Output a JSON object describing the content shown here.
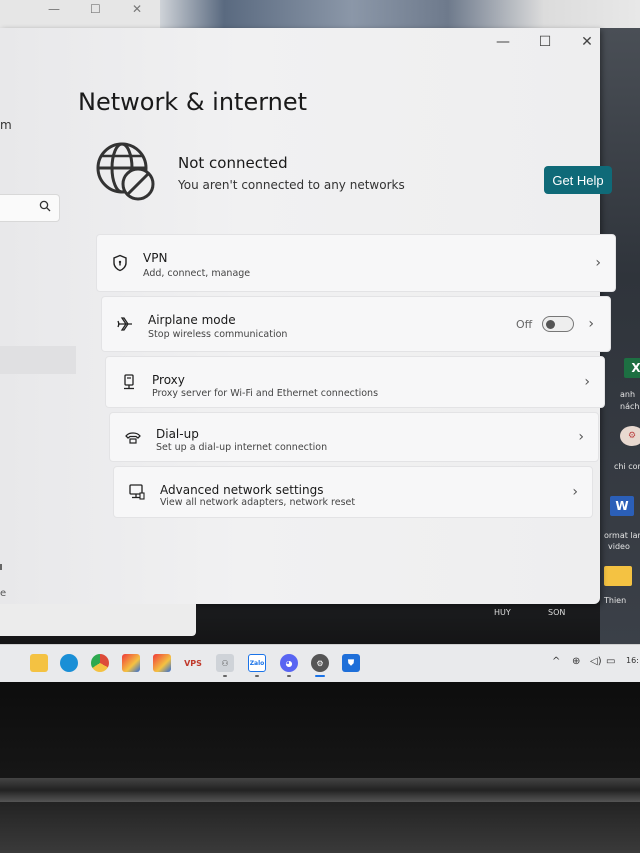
{
  "window": {
    "controls": {
      "minimize": "—",
      "maximize": "☐",
      "close": "✕"
    },
    "left_pane": {
      "crumb": "m",
      "search_icon": "search-icon",
      "ellipsis": "e"
    }
  },
  "page": {
    "title": "Network & internet"
  },
  "status": {
    "title": "Not connected",
    "subtitle": "You aren't connected to any networks",
    "help_button": "Get Help",
    "icon": "globe-blocked-icon"
  },
  "settings": [
    {
      "id": "vpn",
      "icon": "shield-icon",
      "title": "VPN",
      "subtitle": "Add, connect, manage"
    },
    {
      "id": "airplane",
      "icon": "airplane-icon",
      "title": "Airplane mode",
      "subtitle": "Stop wireless communication",
      "toggle_label": "Off",
      "toggle_on": false
    },
    {
      "id": "proxy",
      "icon": "proxy-icon",
      "title": "Proxy",
      "subtitle": "Proxy server for Wi-Fi and Ethernet connections"
    },
    {
      "id": "dialup",
      "icon": "dialup-icon",
      "title": "Dial-up",
      "subtitle": "Set up a dial-up internet connection"
    },
    {
      "id": "advanced",
      "icon": "monitor-network-icon",
      "title": "Advanced network settings",
      "subtitle": "View all network adapters, network reset"
    }
  ],
  "desktop": {
    "right_labels": [
      "anh",
      "nách",
      "chi cor",
      "ormat lar",
      "video",
      "Thien"
    ],
    "bottom_labels": [
      "HUY",
      "SON"
    ],
    "excel_glyph": "X",
    "word_glyph": "W"
  },
  "taskbar": {
    "apps": [
      "file-explorer-icon",
      "edge-icon",
      "chrome-icon",
      "vivaldi-icon",
      "vivaldi-icon",
      "vps-icon",
      "remote-icon",
      "zalo-icon",
      "discord-icon",
      "settings-icon",
      "defender-icon"
    ],
    "vps_label": "VPS",
    "zalo_label": "Zalo",
    "tray": {
      "chevron": "^",
      "time": "16:"
    },
    "colors": {
      "edge": "#1a8fd6",
      "chrome": "#dd4b39",
      "vivaldi": "#ef3939",
      "discord": "#5865f2",
      "defender": "#1e6fd9",
      "folder": "#f4c242"
    }
  }
}
